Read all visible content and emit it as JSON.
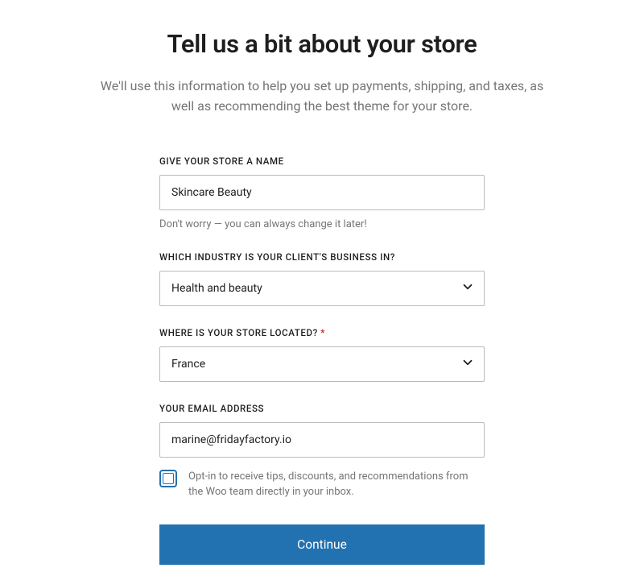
{
  "header": {
    "title": "Tell us a bit about your store",
    "subtitle": "We'll use this information to help you set up payments, shipping, and taxes, as well as recommending the best theme for your store."
  },
  "form": {
    "store_name": {
      "label": "GIVE YOUR STORE A NAME",
      "value": "Skincare Beauty",
      "hint": "Don't worry — you can always change it later!"
    },
    "industry": {
      "label": "WHICH INDUSTRY IS YOUR CLIENT'S BUSINESS IN?",
      "value": "Health and beauty"
    },
    "location": {
      "label": "WHERE IS YOUR STORE LOCATED? ",
      "required_mark": "*",
      "value": "France"
    },
    "email": {
      "label": "YOUR EMAIL ADDRESS",
      "value": "marine@fridayfactory.io"
    },
    "optin": {
      "label": "Opt-in to receive tips, discounts, and recommendations from the Woo team directly in your inbox.",
      "checked": false
    },
    "continue_label": "Continue"
  }
}
